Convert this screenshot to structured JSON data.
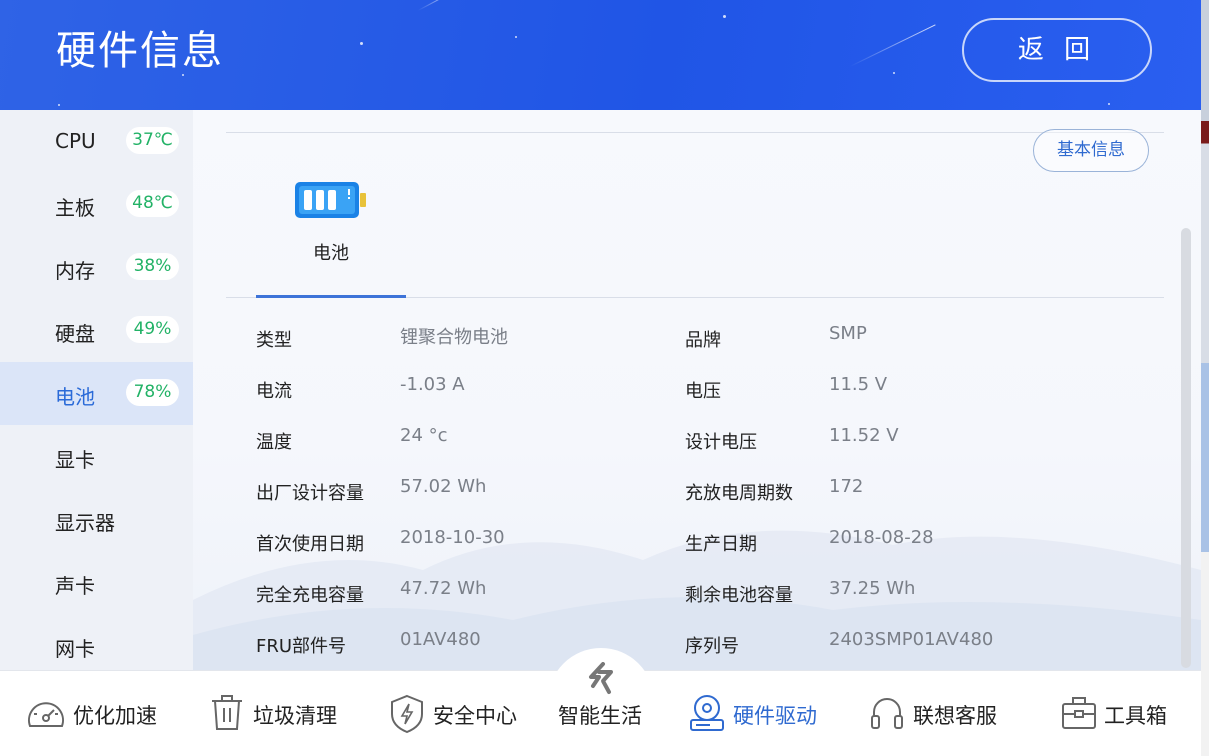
{
  "header": {
    "title": "硬件信息",
    "back_label": "返 回"
  },
  "sidebar": {
    "items": [
      {
        "label": "CPU",
        "badge": "37℃",
        "active": false
      },
      {
        "label": "主板",
        "badge": "48℃",
        "active": false
      },
      {
        "label": "内存",
        "badge": "38%",
        "active": false
      },
      {
        "label": "硬盘",
        "badge": "49%",
        "active": false
      },
      {
        "label": "电池",
        "badge": "78%",
        "active": true
      },
      {
        "label": "显卡",
        "badge": "",
        "active": false
      },
      {
        "label": "显示器",
        "badge": "",
        "active": false
      },
      {
        "label": "声卡",
        "badge": "",
        "active": false
      },
      {
        "label": "网卡",
        "badge": "",
        "active": false
      }
    ]
  },
  "content": {
    "basic_info_button": "基本信息",
    "tab_label": "电池",
    "details": [
      {
        "label": "类型",
        "value": "锂聚合物电池"
      },
      {
        "label": "品牌",
        "value": "SMP"
      },
      {
        "label": "电流",
        "value": "-1.03 A"
      },
      {
        "label": "电压",
        "value": "11.5 V"
      },
      {
        "label": "温度",
        "value": "24 °c"
      },
      {
        "label": "设计电压",
        "value": "11.52 V"
      },
      {
        "label": "出厂设计容量",
        "value": "57.02 Wh"
      },
      {
        "label": "充放电周期数",
        "value": "172"
      },
      {
        "label": "首次使用日期",
        "value": "2018-10-30"
      },
      {
        "label": "生产日期",
        "value": "2018-08-28"
      },
      {
        "label": "完全充电容量",
        "value": "47.72 Wh"
      },
      {
        "label": "剩余电池容量",
        "value": "37.25 Wh"
      },
      {
        "label": "FRU部件号",
        "value": "01AV480"
      },
      {
        "label": "序列号",
        "value": "2403SMP01AV480"
      }
    ]
  },
  "bottom_nav": {
    "items": [
      {
        "label": "优化加速",
        "icon": "speedometer-icon"
      },
      {
        "label": "垃圾清理",
        "icon": "trash-icon"
      },
      {
        "label": "安全中心",
        "icon": "shield-icon"
      },
      {
        "label": "智能生活",
        "icon": "lightning-icon"
      },
      {
        "label": "硬件驱动",
        "icon": "disc-drive-icon",
        "active": true
      },
      {
        "label": "联想客服",
        "icon": "headset-icon"
      },
      {
        "label": "工具箱",
        "icon": "toolbox-icon"
      }
    ]
  },
  "colors": {
    "header_blue": "#2055e6",
    "accent_blue": "#2f6ad0",
    "badge_green": "#22b266",
    "battery_blue": "#1a82e6",
    "battery_tip": "#e8c23a"
  }
}
